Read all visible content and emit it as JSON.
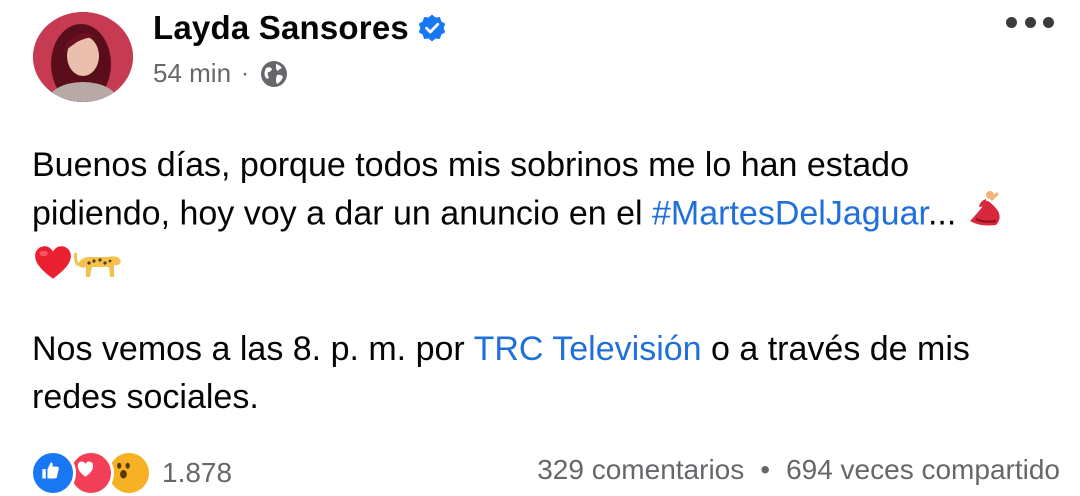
{
  "author": {
    "name": "Layda Sansores",
    "verified": true,
    "time": "54 min",
    "separator": "·",
    "privacy_icon": "globe-icon"
  },
  "menu_icon": "more-dots-icon",
  "post": {
    "para1_text": "Buenos días, porque todos mis sobrinos me lo han estado pidiendo, hoy voy a dar un anuncio en el ",
    "hashtag": "#MartesDelJaguar",
    "para1_tail": "...",
    "emojis_line1": [
      "dancer-emoji"
    ],
    "emojis_line2": [
      "red-heart-emoji",
      "leopard-emoji"
    ],
    "para2_pre": "Nos vemos a las 8. p. m. por ",
    "para2_link": "TRC Televisión",
    "para2_post": " o a través de mis redes sociales."
  },
  "footer": {
    "reaction_icons": [
      "like-icon",
      "love-icon",
      "wow-icon"
    ],
    "reaction_count": "1.878",
    "comments": "329 comentarios",
    "dot": "•",
    "shares": "694 veces compartido"
  },
  "colors": {
    "link": "#216fdb",
    "muted": "#65676b",
    "verified": "#1877f2"
  }
}
